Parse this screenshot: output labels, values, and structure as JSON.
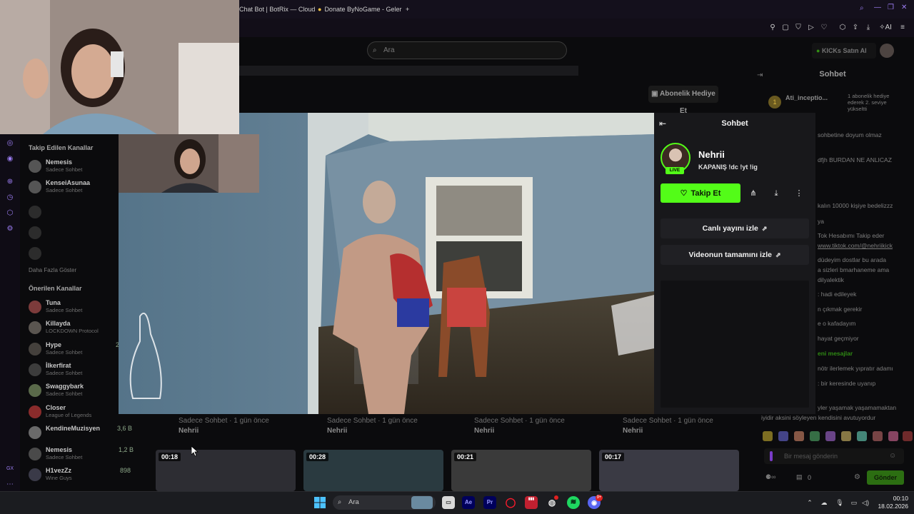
{
  "browser": {
    "tabs": [
      {
        "label": "Chat Bot | BotRix — Cloud"
      },
      {
        "label": "Donate ByNoGame - Geler"
      }
    ],
    "new_tab": "+"
  },
  "kick": {
    "search_placeholder": "Ara",
    "kicks_label": "KICKs Satın Al",
    "gift_sub": "Abonelik Hediye Et",
    "sidebar": {
      "followed_header": "Takip Edilen Kanallar",
      "followed": [
        {
          "name": "Nemesis",
          "sub": "Sadece Sohbet"
        },
        {
          "name": "KenseiAsunaa",
          "sub": "Sadece Sohbet"
        }
      ],
      "show_more": "Daha Fazla Göster",
      "suggested_header": "Önerilen Kanallar",
      "suggested": [
        {
          "name": "Tuna",
          "sub": "Sadece Sohbet",
          "viewers": ""
        },
        {
          "name": "Killayda",
          "sub": "LOCKDOWN Protocol",
          "viewers": ""
        },
        {
          "name": "Hype",
          "sub": "Sadece Sohbet",
          "viewers": "2"
        },
        {
          "name": "İlkerfirat",
          "sub": "Sadece Sohbet",
          "viewers": ""
        },
        {
          "name": "Swaggybark",
          "sub": "Sadece Sohbet",
          "viewers": ""
        },
        {
          "name": "Closer",
          "sub": "League of Legends",
          "viewers": ""
        },
        {
          "name": "KendineMuzisyen",
          "sub": "",
          "viewers": "3,6 B"
        },
        {
          "name": "Nemesis",
          "sub": "Sadece Sohbet",
          "viewers": "1,2 B"
        },
        {
          "name": "H1vezZz",
          "sub": "Wine Guys",
          "viewers": "898"
        }
      ]
    },
    "cards": [
      {
        "line": "Sadece Sohbet · 1 gün önce",
        "channel": "Nehrii"
      },
      {
        "line": "Sadece Sohbet · 1 gün önce",
        "channel": "Nehrii"
      },
      {
        "line": "Sadece Sohbet · 1 gün önce",
        "channel": "Nehrii"
      },
      {
        "line": "Sadece Sohbet · 1 gün önce",
        "channel": "Nehrii"
      }
    ],
    "thumbs": [
      "00:18",
      "00:28",
      "00:21",
      "00:17"
    ],
    "chat": {
      "title": "Sohbet",
      "gifter": "Ati_inceptio...",
      "gift_note": "1 abonelik hediye ederek 2. seviye yükseltti",
      "lines": [
        "sohbetine doyum olmaz",
        "dfjh BURDAN NE ANLICAZ",
        "kalın 10000 kişiye bedelizzz",
        "ya",
        "Tok Hesabımı Takip eder",
        "www.tiktok.com/@nehriikick",
        "düdeyim dostlar bu arada",
        "a sizleri bmarhaneme ama",
        "dilyalektik",
        ": hadi edileyek",
        "n çıkmak gerekir",
        "e o kafadayım",
        "hayat geçmiyor",
        "eni mesajlar",
        "nötr ilerlemek yıpratır adamı",
        ": bir keresinde uyanıp",
        "yler yaşamak yaşamamaktan",
        "iyidir aksini söyleyen kendisini avutuyordur"
      ],
      "input_placeholder": "Bir mesaj gönderin",
      "count": "0",
      "send": "Gönder"
    }
  },
  "player": {
    "panel_title": "Sohbet",
    "streamer": "Nehrii",
    "live": "LIVE",
    "stream_title": "KAPANIŞ !dc !yt !ig",
    "follow": "Takip Et",
    "watch_live": "Canlı yayını izle",
    "watch_full": "Videonun tamamını izle"
  },
  "taskbar": {
    "search": "Ara",
    "time": "00:10",
    "date": "18.02.2026",
    "gx": "GX",
    "discord_badge": "9+"
  },
  "colors": {
    "kick_green": "#53fc18",
    "opera_purple": "#9b7cf2"
  }
}
